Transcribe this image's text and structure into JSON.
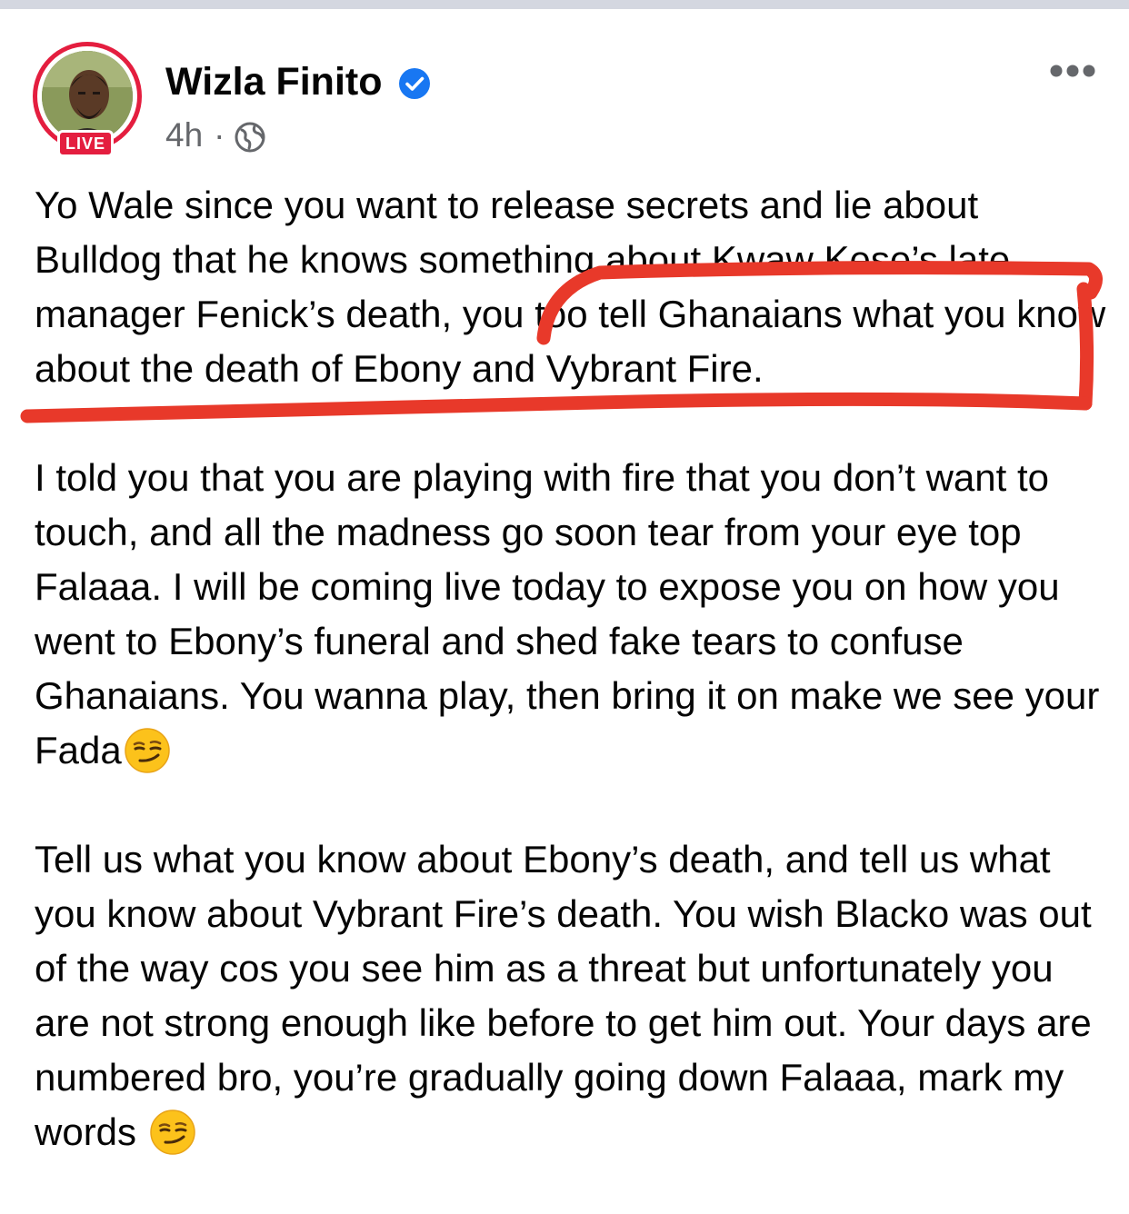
{
  "colors": {
    "live_red": "#e41e3f",
    "verified_blue": "#1877f2",
    "meta_gray": "#65676b",
    "annotation_red": "#e8392a"
  },
  "post": {
    "author": {
      "name": "Wizla Finito",
      "verified": true,
      "live_badge": "LIVE",
      "avatar": "avatar"
    },
    "meta": {
      "time": "4h",
      "separator": "·",
      "audience_icon": "globe-icon"
    },
    "menu_icon": "more-options-icon",
    "paragraphs": [
      "Yo Wale since you want to release secrets and lie about Bulldog that he knows something about Kwaw Kese’s late manager Fenick’s death, you too tell Ghanaians what you know about the death of Ebony and Vybrant Fire.",
      "I told you that you are playing with fire that you don’t want to touch, and all the madness go soon tear from your eye top Falaaa. I will be coming live today to expose you on how you went to Ebony’s funeral and shed fake tears to confuse Ghanaians. You wanna play, then bring it on make we see your Fada",
      "Tell us what you know about Ebony’s death, and tell us what you know about Vybrant Fire’s death. You wish Blacko was out of the way cos you see him as a threat but unfortunately you are not strong enough like before to get him out. Your days are numbered bro, you’re gradually going down Falaaa, mark my words "
    ],
    "emoji": "smirking-face-emoji"
  }
}
